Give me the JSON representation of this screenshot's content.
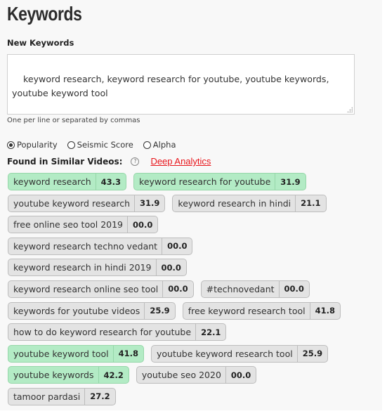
{
  "header": {
    "title": "Keywords"
  },
  "new_keywords": {
    "label": "New Keywords",
    "value": "keyword research, keyword research for youtube, youtube keywords,\nyoutube keyword tool",
    "helper": "One per line or separated by commas"
  },
  "sort": {
    "options": [
      {
        "label": "Popularity",
        "checked": true
      },
      {
        "label": "Seismic Score",
        "checked": false
      },
      {
        "label": "Alpha",
        "checked": false
      }
    ]
  },
  "found": {
    "label": "Found in Similar Videos:",
    "help_icon": "?",
    "link_label": "Deep Analytics",
    "link_color": "#e8141a"
  },
  "colors": {
    "highlight_bg": "#b3ebc5",
    "default_bg": "#e3e3e3"
  },
  "tag_rows": [
    [
      {
        "label": "keyword research",
        "score": "43.3",
        "highlight": true
      },
      {
        "label": "keyword research for youtube",
        "score": "31.9",
        "highlight": true
      }
    ],
    [
      {
        "label": "youtube keyword research",
        "score": "31.9",
        "highlight": false
      },
      {
        "label": "keyword research in hindi",
        "score": "21.1",
        "highlight": false
      }
    ],
    [
      {
        "label": "free online seo tool 2019",
        "score": "00.0",
        "highlight": false
      }
    ],
    [
      {
        "label": "keyword research techno vedant",
        "score": "00.0",
        "highlight": false
      }
    ],
    [
      {
        "label": "keyword research in hindi 2019",
        "score": "00.0",
        "highlight": false
      }
    ],
    [
      {
        "label": "keyword research online seo tool",
        "score": "00.0",
        "highlight": false
      },
      {
        "label": "#technovedant",
        "score": "00.0",
        "highlight": false
      }
    ],
    [
      {
        "label": "keywords for youtube videos",
        "score": "25.9",
        "highlight": false
      },
      {
        "label": "free keyword research tool",
        "score": "41.8",
        "highlight": false
      }
    ],
    [
      {
        "label": "how to do keyword research for youtube",
        "score": "22.1",
        "highlight": false
      }
    ],
    [
      {
        "label": "youtube keyword tool",
        "score": "41.8",
        "highlight": true
      },
      {
        "label": "youtube keyword research tool",
        "score": "25.9",
        "highlight": false
      }
    ],
    [
      {
        "label": "youtube keywords",
        "score": "42.2",
        "highlight": true
      },
      {
        "label": "youtube seo 2020",
        "score": "00.0",
        "highlight": false
      }
    ],
    [
      {
        "label": "tamoor pardasi",
        "score": "27.2",
        "highlight": false
      }
    ]
  ]
}
